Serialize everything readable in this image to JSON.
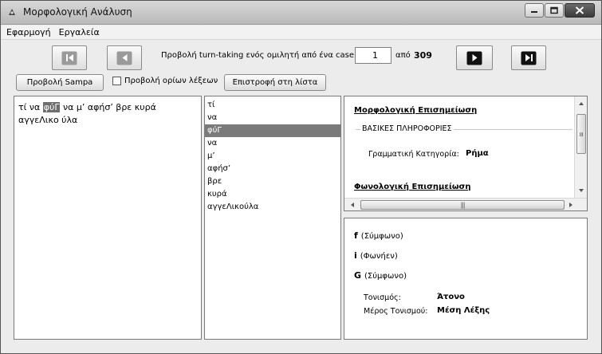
{
  "window": {
    "title": "Μορφολογική Ανάλυση"
  },
  "menu": {
    "items": [
      "Εφαρμογή",
      "Εργαλεία"
    ]
  },
  "navigation": {
    "view_label": "Προβολή turn-taking ενός ομιλητή από ένα case",
    "current_case": "1",
    "of_label": "από",
    "total_cases": "309"
  },
  "toolbar": {
    "sampa_button": "Προβολή Sampa",
    "word_boundaries_checkbox": "Προβολή ορίων λέξεων",
    "word_boundaries_checked": false,
    "back_to_list_button": "Επιστροφή στη λίστα"
  },
  "utterance": {
    "before": "τί να ",
    "highlight": "φύΓ",
    "after": " να μ’ αφήσ’ βρε κυρά αγγεΛικο ύλα"
  },
  "words": [
    {
      "text": "τί",
      "selected": false
    },
    {
      "text": "να",
      "selected": false
    },
    {
      "text": "φύΓ",
      "selected": true
    },
    {
      "text": "να",
      "selected": false
    },
    {
      "text": "μ’",
      "selected": false
    },
    {
      "text": "αφήσ’",
      "selected": false
    },
    {
      "text": "βρε",
      "selected": false
    },
    {
      "text": "κυρά",
      "selected": false
    },
    {
      "text": "αγγεΛικούλα",
      "selected": false
    }
  ],
  "morphology": {
    "heading": "Μορφολογική Επισημείωση",
    "basic_info_label": "ΒΑΣΙΚΕΣ ΠΛΗΡΟΦΟΡΙΕΣ",
    "grammatical_category_label": "Γραμματική Κατηγορία:",
    "grammatical_category_value": "Ρήμα",
    "phonological_heading": "Φωνολογική Επισημείωση"
  },
  "phonology": {
    "phonemes": [
      {
        "symbol": "f",
        "type": "(Σύμφωνο)"
      },
      {
        "symbol": "i",
        "type": "(Φωνήεν)"
      },
      {
        "symbol": "G",
        "type": "(Σύμφωνο)"
      }
    ],
    "stress_label": "Τονισμός:",
    "stress_value": "Άτονο",
    "stress_position_label": "Μέρος Τονισμού:",
    "stress_position_value": "Μέση Λέξης"
  }
}
